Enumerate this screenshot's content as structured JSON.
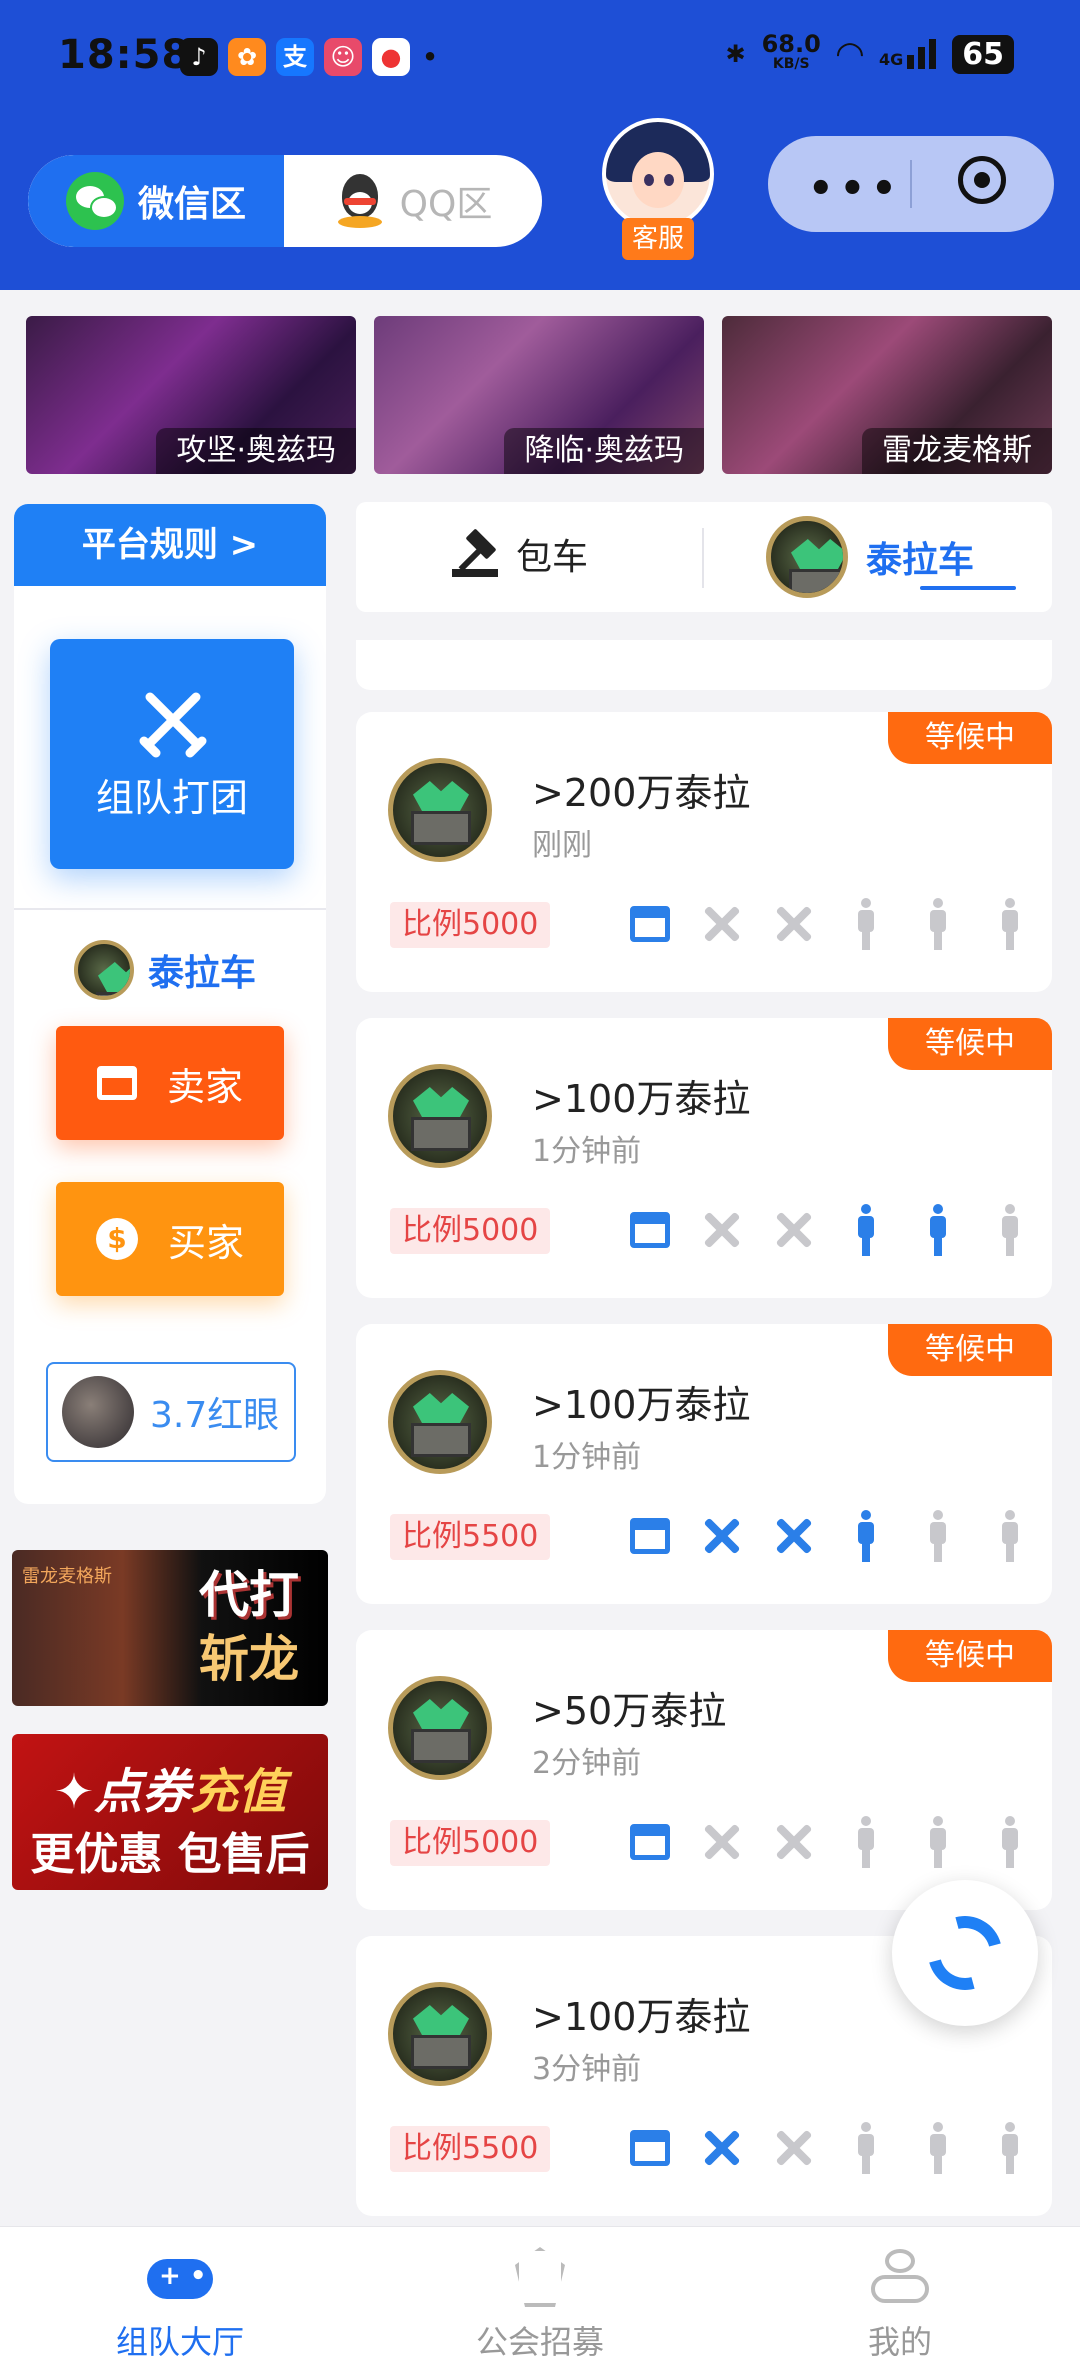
{
  "status_bar": {
    "time": "18:58",
    "network_speed": "68.0",
    "network_unit": "KB/S",
    "signal": "4G",
    "battery": "65",
    "app_icons": [
      "tiktok-icon",
      "app-icon",
      "alipay-icon",
      "game-icon",
      "map-icon"
    ]
  },
  "header": {
    "region_active": "微信区",
    "region_inactive": "QQ区",
    "service_label": "客服"
  },
  "banners": [
    {
      "caption": "攻坚·奥兹玛"
    },
    {
      "caption": "降临·奥兹玛"
    },
    {
      "caption": "雷龙麦格斯"
    }
  ],
  "sidebar": {
    "rules_label": "平台规则 >",
    "team_button": "组队打团",
    "game_name": "泰拉车",
    "sell_label": "卖家",
    "buy_label": "买家",
    "redeye_label": "3.7红眼",
    "promo1_small": "雷龙麦格斯",
    "promo1_line1": "代打",
    "promo1_line2": "斩龙",
    "promo2_line1_a": "✦点券",
    "promo2_line1_b": "充值",
    "promo2_line2": "更优惠 包售后"
  },
  "tabs": {
    "option1": "包车",
    "option2": "泰拉车"
  },
  "orders": [
    {
      "badge": "等候中",
      "title": ">200万泰拉",
      "time": "刚刚",
      "ratio": "比例5000",
      "slots": [
        "shop",
        "sword-off",
        "sword-off",
        "person-off",
        "person-off",
        "person-off"
      ]
    },
    {
      "badge": "等候中",
      "title": ">100万泰拉",
      "time": "1分钟前",
      "ratio": "比例5000",
      "slots": [
        "shop",
        "sword-off",
        "sword-off",
        "person-on",
        "person-on",
        "person-off"
      ]
    },
    {
      "badge": "等候中",
      "title": ">100万泰拉",
      "time": "1分钟前",
      "ratio": "比例5500",
      "slots": [
        "shop",
        "sword-on",
        "sword-on",
        "person-on",
        "person-off",
        "person-off"
      ]
    },
    {
      "badge": "等候中",
      "title": ">50万泰拉",
      "time": "2分钟前",
      "ratio": "比例5000",
      "slots": [
        "shop",
        "sword-off",
        "sword-off",
        "person-off",
        "person-off",
        "person-off"
      ]
    },
    {
      "badge": "",
      "title": ">100万泰拉",
      "time": "3分钟前",
      "ratio": "比例5500",
      "slots": [
        "shop",
        "sword-on",
        "sword-off",
        "person-off",
        "person-off",
        "person-off"
      ]
    }
  ],
  "bottom_nav": [
    {
      "label": "组队大厅"
    },
    {
      "label": "公会招募"
    },
    {
      "label": "我的"
    }
  ],
  "colors": {
    "brand_blue": "#1e4fd6",
    "accent_blue": "#1f80f5",
    "orange": "#ff6a10",
    "ratio_red": "#e54545"
  }
}
